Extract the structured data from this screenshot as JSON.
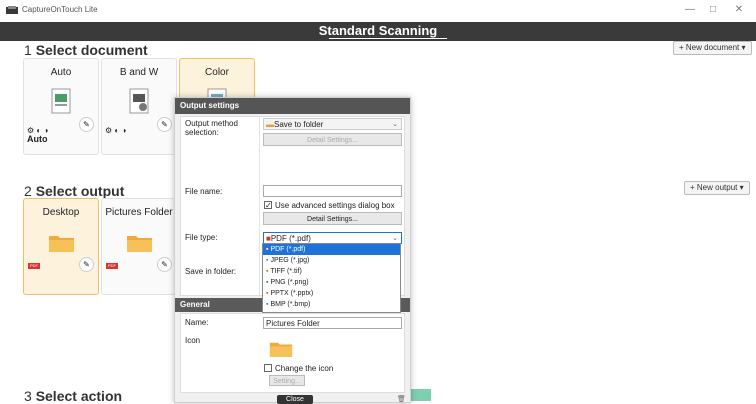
{
  "window": {
    "title": "CaptureOnTouch Lite",
    "controls": [
      "—",
      "□",
      "✕"
    ]
  },
  "header": {
    "title": "Standard Scanning"
  },
  "section1": {
    "num": "1",
    "title": "Select document",
    "new_btn": "+ New document ▾"
  },
  "documents": [
    {
      "label": "Auto",
      "sub": "Auto",
      "selected": false
    },
    {
      "label": "B and W",
      "sub": "",
      "selected": false
    },
    {
      "label": "Color",
      "sub": "",
      "selected": true
    }
  ],
  "section2": {
    "num": "2",
    "title": "Select output",
    "new_btn": "+ New output ▾"
  },
  "outputs": [
    {
      "label": "Desktop",
      "selected": true
    },
    {
      "label": "Pictures Folder",
      "selected": false
    }
  ],
  "section3": {
    "num": "3",
    "title": "Select action"
  },
  "dialog": {
    "title": "Output settings",
    "method_label": "Output method selection:",
    "method_value": "Save to folder",
    "detail_btn_disabled": "Detail Settings...",
    "file_name_label": "File name:",
    "file_name_value": "",
    "use_advanced": "Use advanced settings dialog box",
    "detail_btn": "Detail Settings...",
    "file_type_label": "File type:",
    "file_type_value": "PDF (*.pdf)",
    "file_type_options": [
      "PDF (*.pdf)",
      "JPEG (*.jpg)",
      "TIFF (*.tif)",
      "PNG (*.png)",
      "PPTX (*.pptx)",
      "BMP (*.bmp)"
    ],
    "save_in_label": "Save in folder:",
    "general_title": "General",
    "name_label": "Name:",
    "name_value": "Pictures Folder",
    "icon_label": "Icon",
    "change_icon": "Change the icon",
    "setting_btn": "Setting...",
    "close_btn": "Close"
  },
  "colors": {
    "header_bg": "#3a3a3a",
    "selected_card": "#fdf3dc",
    "highlight": "#1e73d8"
  }
}
